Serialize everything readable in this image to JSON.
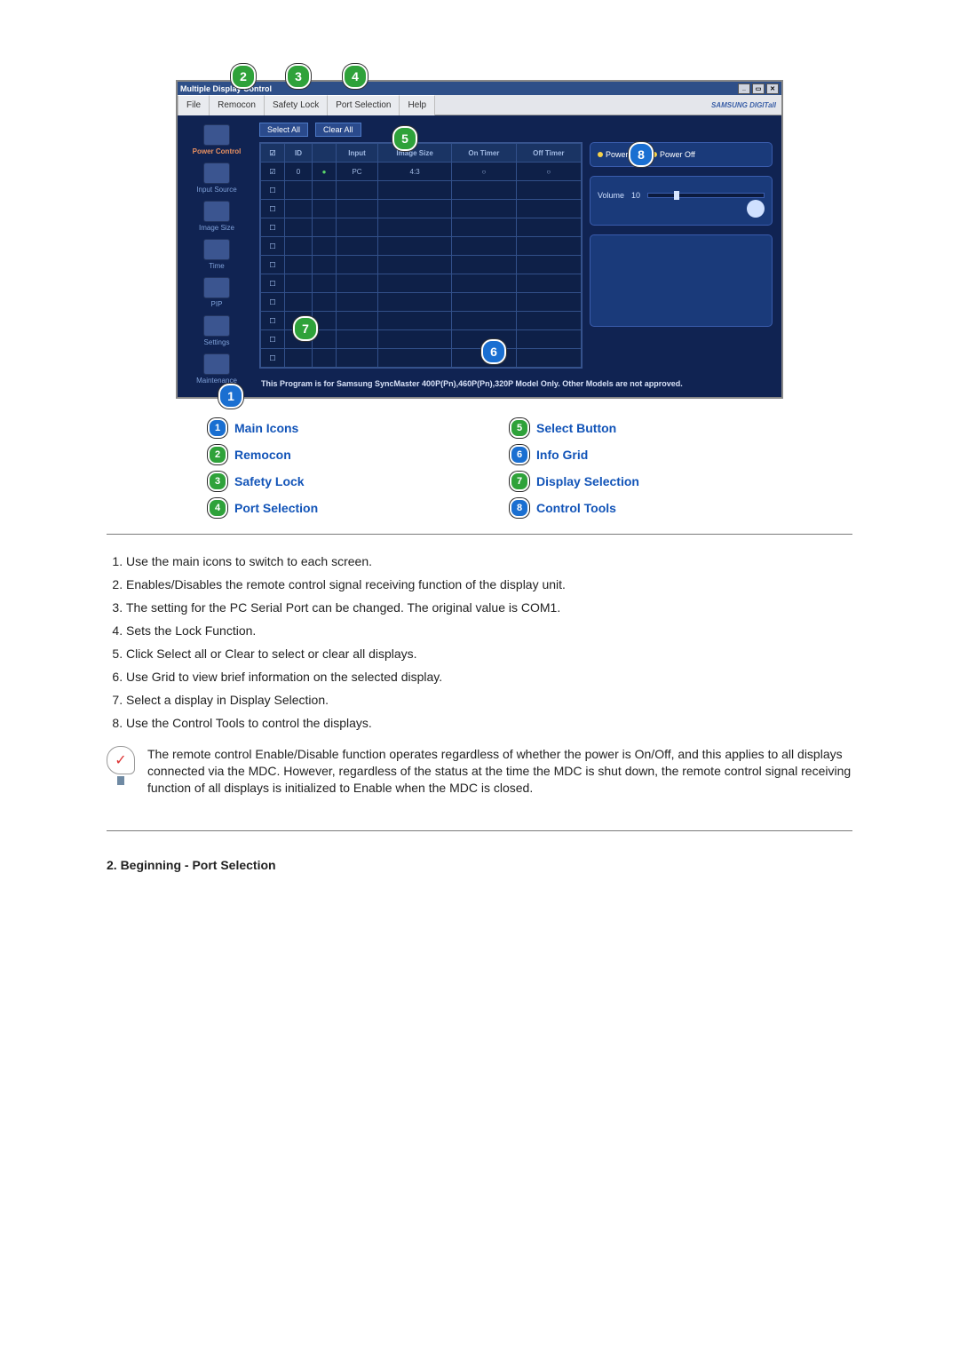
{
  "window": {
    "title": "Multiple Display Control",
    "menus": [
      "File",
      "Remocon",
      "Safety Lock",
      "Port Selection",
      "Help"
    ],
    "brand": "SAMSUNG DIGITall"
  },
  "sidebar": [
    {
      "label": "Power Control",
      "active": true
    },
    {
      "label": "Input Source",
      "active": false
    },
    {
      "label": "Image Size",
      "active": false
    },
    {
      "label": "Time",
      "active": false
    },
    {
      "label": "PIP",
      "active": false
    },
    {
      "label": "Settings",
      "active": false
    },
    {
      "label": "Maintenance",
      "active": false
    }
  ],
  "buttons": {
    "select_all": "Select All",
    "clear_all": "Clear All"
  },
  "grid": {
    "headers": [
      "",
      "ID",
      "",
      "Input",
      "Image Size",
      "On Timer",
      "Off Timer"
    ],
    "row": [
      "☑",
      "0",
      "●",
      "PC",
      "4:3",
      "○",
      "○"
    ]
  },
  "control": {
    "power_on": "Power On",
    "power_off": "Power Off",
    "volume_label": "Volume",
    "volume_value": "10"
  },
  "footer_msg": "This Program is for Samsung SyncMaster 400P(Pn),460P(Pn),320P  Model Only. Other Models are not approved.",
  "legend": [
    {
      "n": "1",
      "color": "blue",
      "text": "Main Icons"
    },
    {
      "n": "2",
      "color": "green",
      "text": "Remocon"
    },
    {
      "n": "3",
      "color": "green",
      "text": "Safety Lock"
    },
    {
      "n": "4",
      "color": "green",
      "text": "Port Selection"
    },
    {
      "n": "5",
      "color": "green",
      "text": "Select Button"
    },
    {
      "n": "6",
      "color": "blue",
      "text": "Info Grid"
    },
    {
      "n": "7",
      "color": "green",
      "text": "Display Selection"
    },
    {
      "n": "8",
      "color": "blue",
      "text": "Control Tools"
    }
  ],
  "explanations": [
    "Use the main icons to switch to each screen.",
    "Enables/Disables the remote control signal receiving function of the display unit.",
    "The setting for the PC Serial Port can be changed. The original value is COM1.",
    "Sets the Lock Function.",
    "Click Select all or Clear to select or clear all displays.",
    "Use Grid to view brief information on the selected display.",
    "Select a display in Display Selection.",
    "Use the Control Tools to control the displays."
  ],
  "note": "The remote control Enable/Disable function operates regardless of whether the power is On/Off, and this applies to all displays connected via the MDC. However, regardless of the status at the time the MDC is shut down, the remote control signal receiving function of all displays is initialized to Enable when the MDC is closed.",
  "heading": "2. Beginning - Port Selection"
}
